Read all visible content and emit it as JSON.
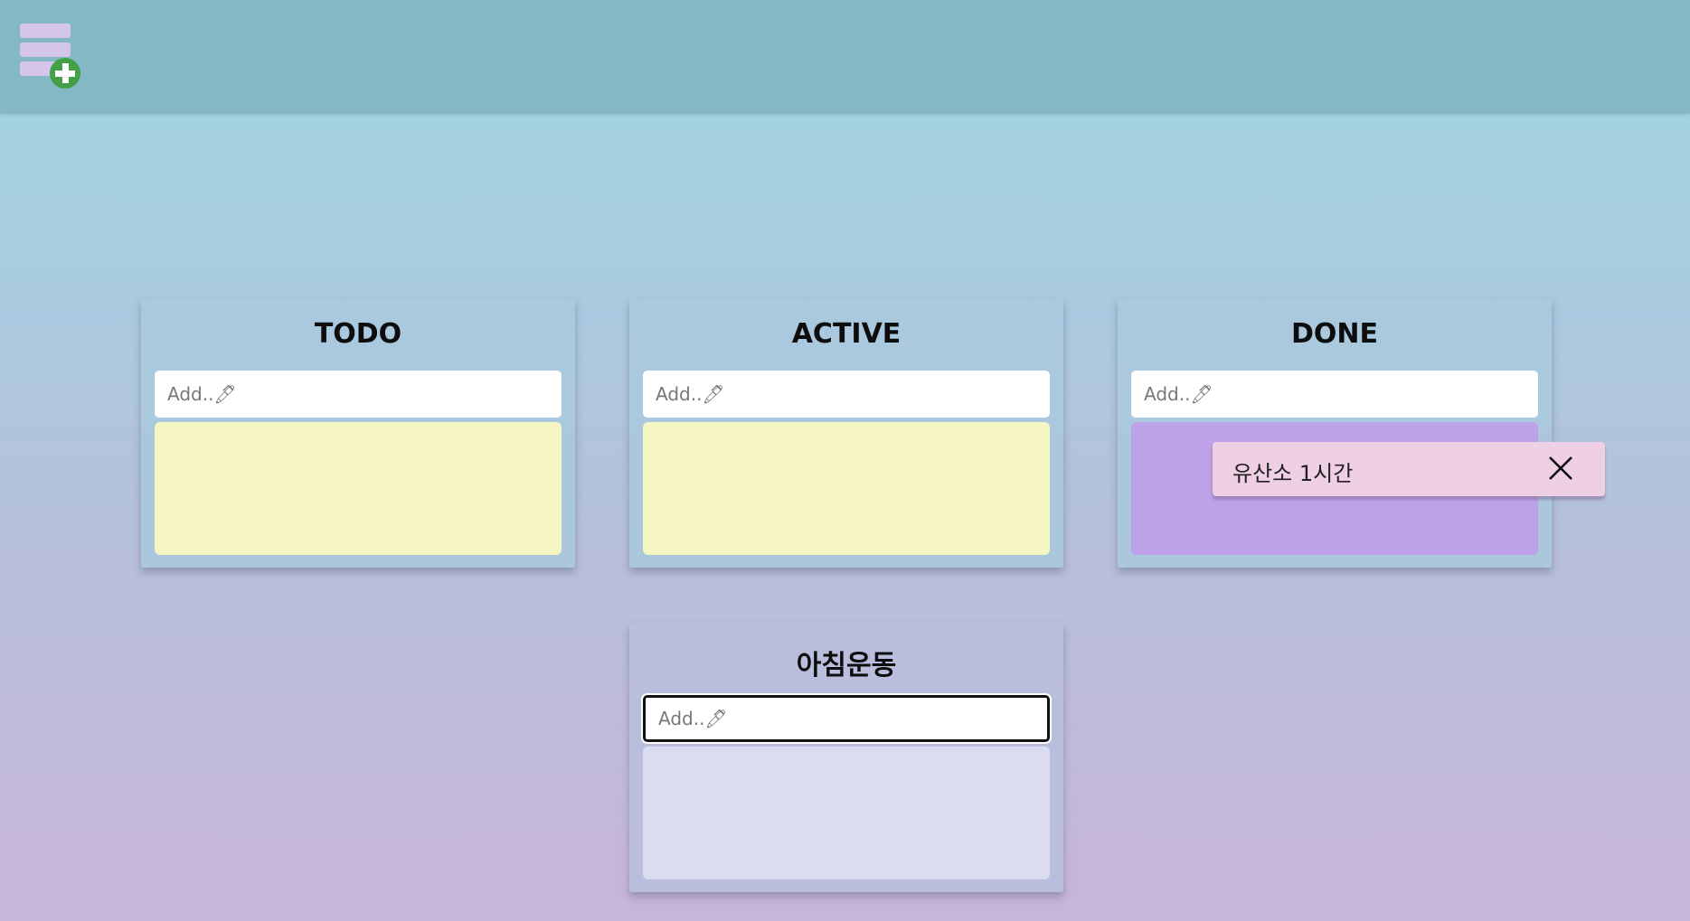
{
  "header": {
    "add_board_icon": "add-list-icon",
    "add_board_plus_color": "#43a047",
    "add_board_bars_color": "#d5c5ea"
  },
  "boards": [
    {
      "title": "TODO",
      "input_placeholder": "Add..🖊",
      "dropzone_color": "#f5f6c3"
    },
    {
      "title": "ACTIVE",
      "input_placeholder": "Add..🖊",
      "dropzone_color": "#f5f6c3"
    },
    {
      "title": "DONE",
      "input_placeholder": "Add..🖊",
      "dropzone_color": "#bda2ea"
    },
    {
      "title": "아침운동",
      "input_placeholder": "Add..🖊",
      "dropzone_color": "#dcdcf0"
    }
  ],
  "dragging_task": {
    "text": "유산소 1시간",
    "delete_icon": "close-icon",
    "card_color": "#efcfe3"
  }
}
